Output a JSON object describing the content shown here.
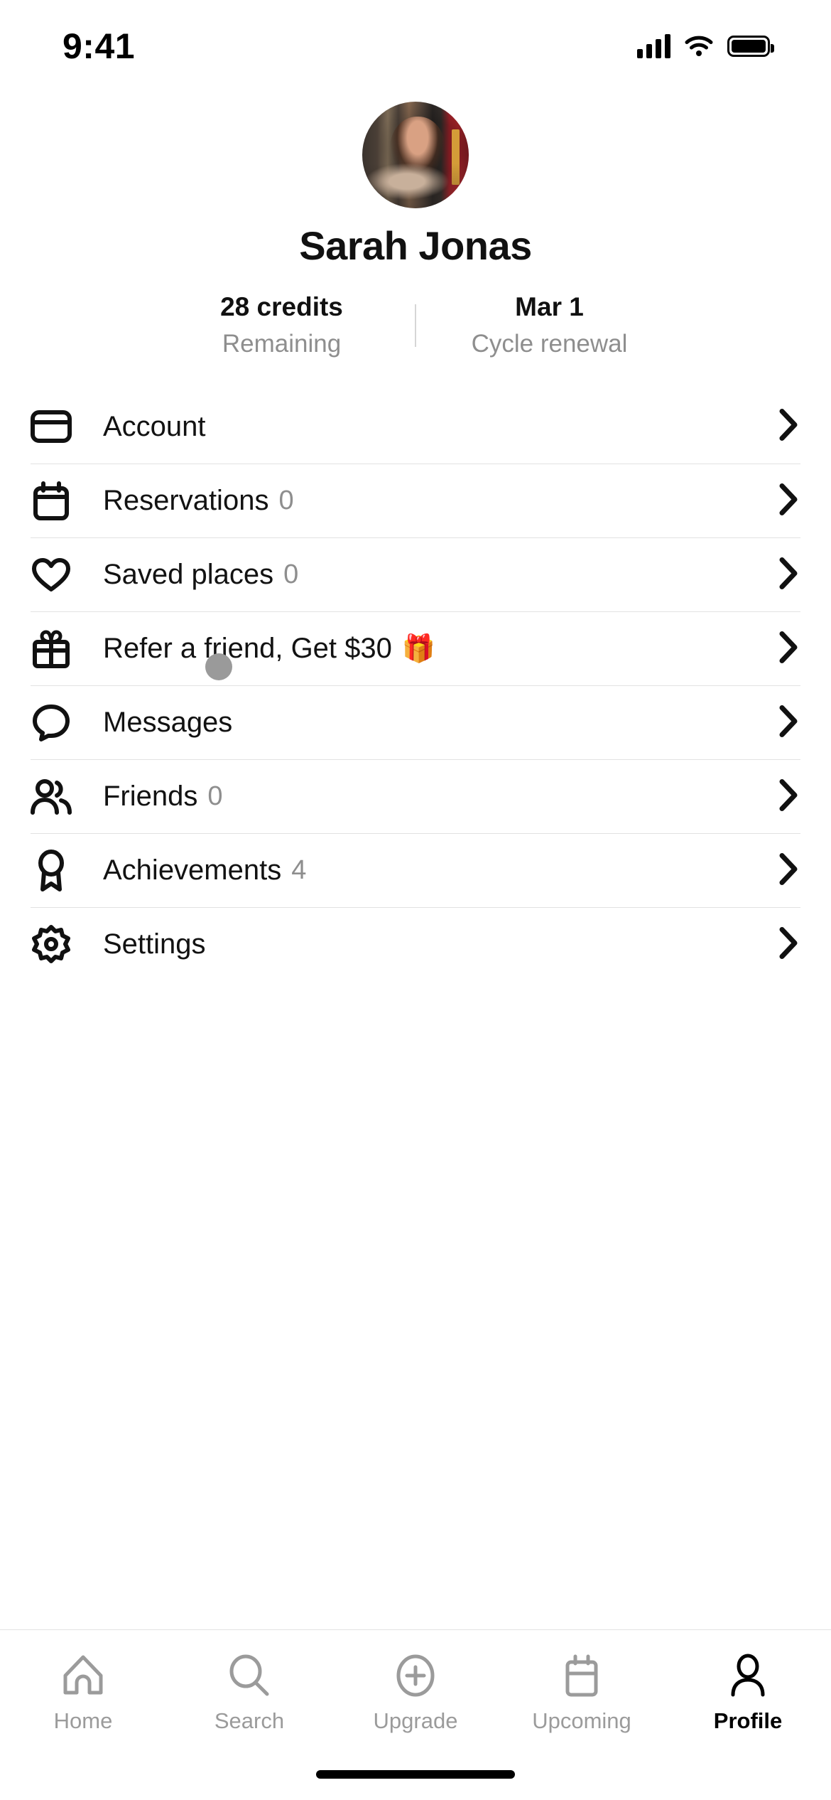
{
  "status_bar": {
    "time": "9:41",
    "cellular_icon": "signal-bars-icon",
    "wifi_icon": "wifi-icon",
    "battery_icon": "battery-full-icon"
  },
  "profile": {
    "avatar_icon": "user-avatar-photo",
    "name": "Sarah Jonas"
  },
  "stats": [
    {
      "value": "28 credits",
      "label": "Remaining"
    },
    {
      "value": "Mar 1",
      "label": "Cycle renewal"
    }
  ],
  "menu": [
    {
      "icon": "credit-card-icon",
      "label": "Account",
      "count": "",
      "emoji": "",
      "chevron": "chevron-right-icon"
    },
    {
      "icon": "calendar-icon",
      "label": "Reservations",
      "count": "0",
      "emoji": "",
      "chevron": "chevron-right-icon"
    },
    {
      "icon": "heart-icon",
      "label": "Saved places",
      "count": "0",
      "emoji": "",
      "chevron": "chevron-right-icon"
    },
    {
      "icon": "gift-icon",
      "label": "Refer a friend, Get $30",
      "count": "",
      "emoji": "🎁",
      "chevron": "chevron-right-icon"
    },
    {
      "icon": "chat-bubble-icon",
      "label": "Messages",
      "count": "",
      "emoji": "",
      "chevron": "chevron-right-icon"
    },
    {
      "icon": "people-icon",
      "label": "Friends",
      "count": "0",
      "emoji": "",
      "chevron": "chevron-right-icon"
    },
    {
      "icon": "award-icon",
      "label": "Achievements",
      "count": "4",
      "emoji": "",
      "chevron": "chevron-right-icon"
    },
    {
      "icon": "gear-icon",
      "label": "Settings",
      "count": "",
      "emoji": "",
      "chevron": "chevron-right-icon"
    }
  ],
  "tabs": [
    {
      "icon": "home-icon",
      "label": "Home",
      "active": false
    },
    {
      "icon": "search-icon",
      "label": "Search",
      "active": false
    },
    {
      "icon": "plus-circle-icon",
      "label": "Upgrade",
      "active": false
    },
    {
      "icon": "calendar-icon",
      "label": "Upcoming",
      "active": false
    },
    {
      "icon": "person-icon",
      "label": "Profile",
      "active": true
    }
  ],
  "colors": {
    "text_primary": "#121212",
    "text_muted": "#8e8e8e",
    "divider": "#e2e2e2",
    "tab_inactive": "#9b9b9b",
    "cursor": "#9a9a9a",
    "background": "#ffffff"
  },
  "cursor": {
    "name": "pointer-dot"
  }
}
